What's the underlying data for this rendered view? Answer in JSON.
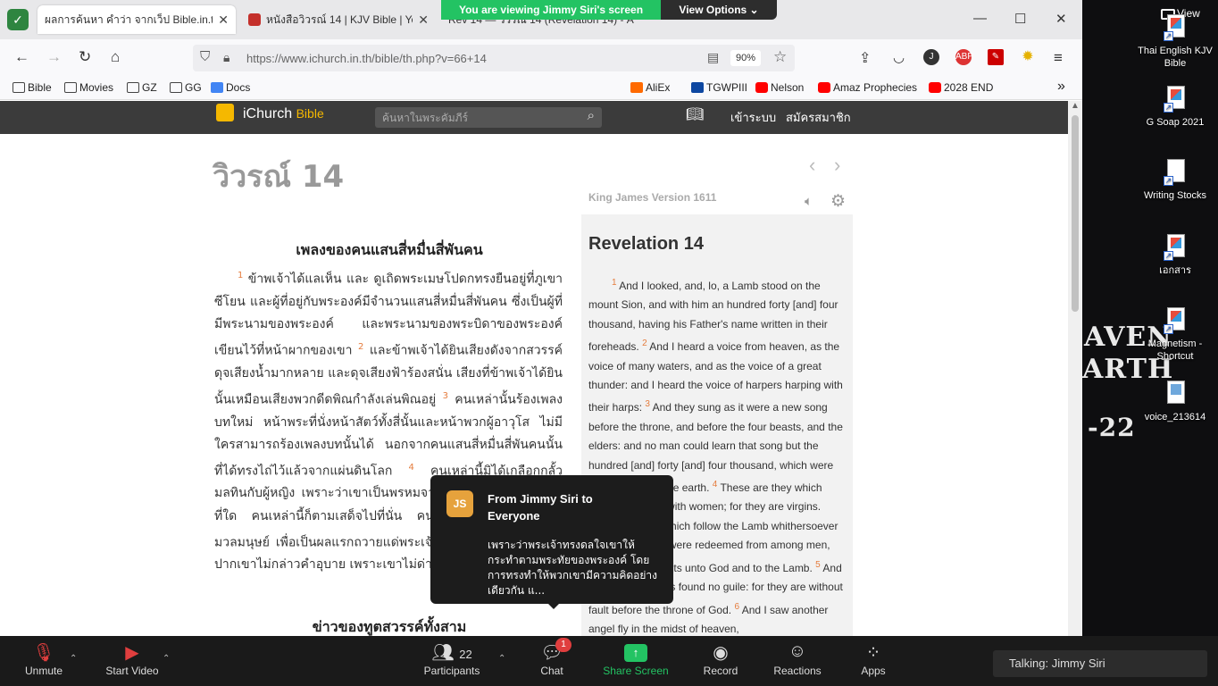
{
  "browser": {
    "tabs": [
      {
        "title": "ผลการค้นหา คำว่า จากเว็ป Bible.in.th"
      },
      {
        "title": "หนังสือวิวรณ์ 14 | KJV Bible | YouT"
      },
      {
        "title": "Rev 14 — วิวรณ์ 14 (Revelation 14) - A"
      }
    ],
    "url": "https://www.ichurch.in.th/bible/th.php?v=66+14",
    "zoom": "90%",
    "bookmarks": [
      "Bible",
      "Movies",
      "GZ",
      "GG",
      "Docs",
      "AliEx",
      "TGWPIII",
      "Nelson",
      "Amaz Prophecies",
      "2028 END"
    ]
  },
  "site": {
    "logo": "iChurch",
    "logo_sub": "Bible",
    "search_placeholder": "ค้นหาในพระคัมภีร์",
    "login": "เข้าระบบ",
    "register": "สมัครสมาชิก",
    "chapter_title": "วิวรณ์ 14",
    "thai_heading": "เพลงของคนแสนสี่หมื่นสี่พันคน",
    "thai_text_1": "ข้าพเจ้าได้แลเห็น และ ดูเถิดพระเมษโปดกทรงยืนอยู่ที่ภูเขาซีโยน และผู้ที่อยู่กับพระองค์มีจำนวนแสนสี่หมื่นสี่พันคน ซึ่งเป็นผู้ที่มีพระนามของพระองค์ และพระนามของพระบิดาของพระองค์เขียนไว้ที่หน้าผากของเขา",
    "thai_text_2": "และข้าพเจ้าได้ยินเสียงดังจากสวรรค์ดุจเสียงน้ำมากหลาย และดุจเสียงฟ้าร้องสนั่น เสียงที่ข้าพเจ้าได้ยินนั้นเหมือนเสียงพวกดีดพิณกำลังเล่นพิณอยู่",
    "thai_text_3": "คนเหล่านั้นร้องเพลงบทใหม่ หน้าพระที่นั่งหน้าสัตว์ทั้งสี่นั้นและหน้าพวกผู้อาวุโส ไม่มีใครสามารถร้องเพลงบทนั้นได้ นอกจากคนแสนสี่หมื่นสี่พันคนนั้น ที่ได้ทรงไถ่ไว้แล้วจากแผ่นดินโลก",
    "thai_text_4": "คนเหล่านี้มิได้เกลือกกลั้วมลทินกับผู้หญิง เพราะว่าเขาเป็นพรหมจารี พระเมษโปดกเสด็จไปที่ใด คนเหล่านี้ก็ตามเสด็จไปที่นั่น คนเหล่านี้เป็นผู้ที่ทรงไถ่จากมวลมนุษย์ เพื่อเป็นผลแรกถวายแด่พระเจ้าและแด่พระเมษโปดก",
    "thai_text_5": "ปากเขาไม่กล่าวคำอุบาย เพราะเขาไม่ด่างพร้อยเลย",
    "thai_heading_2": "ข่าวของทูตสวรรค์ทั้งสาม",
    "kjv_label": "King James Version 1611",
    "en_heading": "Revelation 14",
    "en_text_1": "And I looked, and, lo, a Lamb stood on the mount Sion, and with him an hundred forty [and] four thousand, having his Father's name written in their foreheads.",
    "en_text_2": "And I heard a voice from heaven, as the voice of many waters, and as the voice of a great thunder: and I heard the voice of harpers harping with their harps:",
    "en_text_3": "And they sung as it were a new song before the throne, and before the four beasts, and the elders: and no man could learn that song but the hundred [and] forty [and] four thousand, which were redeemed from the earth.",
    "en_text_4": "These are they which were not defiled with women; for they are virgins. These are they which follow the Lamb whithersoever he goeth. These were redeemed from among men, [being] the firstfruits unto God and to the Lamb.",
    "en_text_5": "And in their mouth was found no guile: for they are without fault before the throne of God.",
    "en_text_6": "And I saw another angel fly in the midst of heaven,",
    "verse_nums": [
      "1",
      "2",
      "3",
      "4",
      "5",
      "6"
    ]
  },
  "desktop": {
    "view": "View",
    "icons": [
      "Thai English KJV Bible",
      "G Soap 2021",
      "Writing Stocks",
      "เอกสาร",
      "Magnetism - Shortcut",
      "voice_213614"
    ],
    "wallpaper": [
      "AVEN",
      "ARTH",
      "-22"
    ]
  },
  "zoom": {
    "banner": "You are viewing Jimmy Siri's screen",
    "view_options": "View Options ⌄",
    "chat_initials": "JS",
    "chat_from": "From Jimmy Siri to Everyone",
    "chat_message": "เพราะว่าพระเจ้าทรงดลใจเขาให้กระทำตามพระทัยของพระองค์ โดยการทรงทำให้พวกเขามีความคิดอย่างเดียวกัน แ...",
    "toolbar": {
      "unmute": "Unmute",
      "start_video": "Start Video",
      "participants": "Participants",
      "participant_count": "22",
      "chat": "Chat",
      "chat_badge": "1",
      "share": "Share Screen",
      "record": "Record",
      "reactions": "Reactions",
      "apps": "Apps"
    },
    "talking": "Talking: Jimmy Siri"
  },
  "colors": {
    "zoom_green": "#23c363",
    "verse_orange": "#e57c3d",
    "logo_yellow": "#f5b800"
  }
}
